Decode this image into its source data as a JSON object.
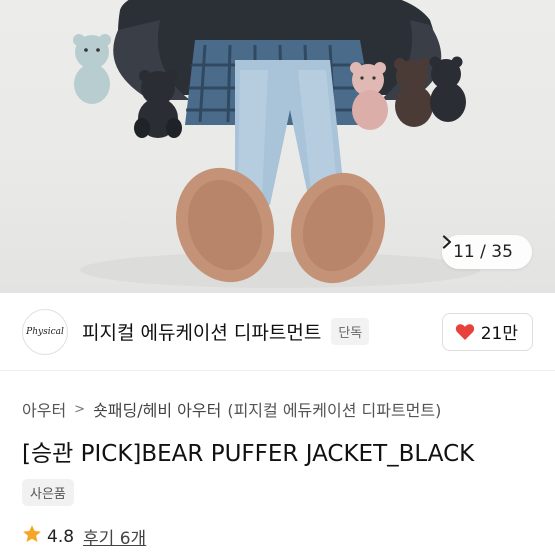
{
  "gallery": {
    "current": "11",
    "total": "35",
    "separator": "/",
    "next_icon": "chevron-right-icon"
  },
  "brand": {
    "logo_text": "Physical",
    "name": "피지컬 에듀케이션 디파트먼트",
    "tag": "단독"
  },
  "like": {
    "icon": "heart-icon",
    "count": "21만",
    "color": "#e8413c"
  },
  "breadcrumb": {
    "level1": "아우터",
    "separator": ">",
    "level2": "숏패딩/헤비 아우터",
    "brand_note": "(피지컬 에듀케이션 디파트먼트)"
  },
  "product": {
    "title": "[승관 PICK]BEAR PUFFER JACKET_BLACK",
    "badge": "사은품"
  },
  "rating": {
    "icon": "star-icon",
    "star_color": "#f5a623",
    "score": "4.8",
    "reviews": "후기 6개"
  }
}
